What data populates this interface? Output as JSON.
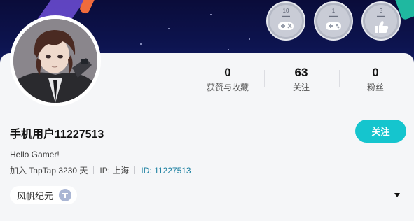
{
  "profile": {
    "username": "手机用户11227513",
    "bio": "Hello Gamer!",
    "joined": "加入 TapTap 3230 天",
    "location": "IP: 上海",
    "user_id": "ID: 11227513"
  },
  "stats": [
    {
      "value": "0",
      "label": "获赞与收藏"
    },
    {
      "value": "63",
      "label": "关注"
    },
    {
      "value": "0",
      "label": "粉丝"
    }
  ],
  "actions": {
    "follow_label": "关注"
  },
  "honor": {
    "label": "风帆纪元",
    "icon": "game-logo-icon"
  },
  "badges": [
    {
      "number": "10",
      "icon": "gamepad-x-icon"
    },
    {
      "number": "1",
      "icon": "gamepad-icon"
    },
    {
      "number": "3",
      "icon": "thumbs-up-icon"
    }
  ],
  "colors": {
    "accent": "#15c5ce",
    "banner": "#0b1040",
    "id_link": "#1a7fa0"
  }
}
